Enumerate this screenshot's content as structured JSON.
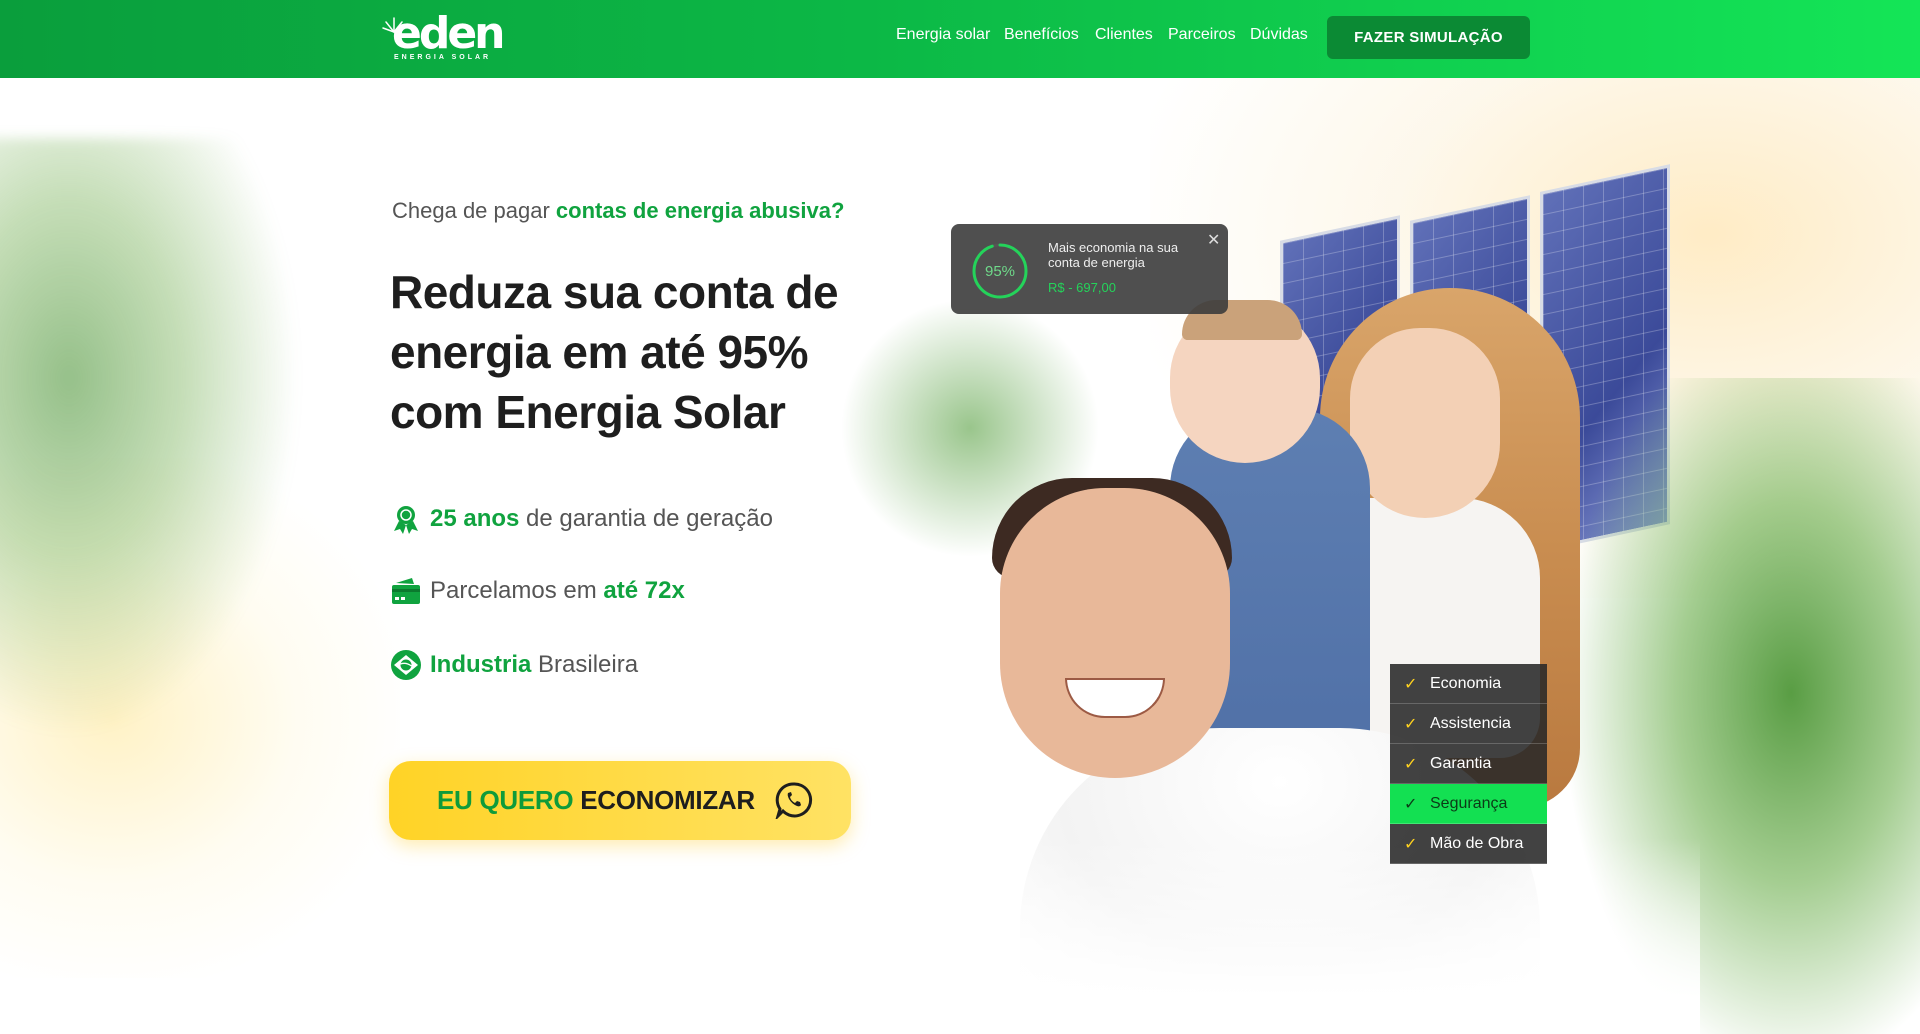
{
  "header": {
    "logo_text": "eden",
    "logo_sub": "ENERGIA SOLAR",
    "nav": [
      {
        "label": "Energia solar"
      },
      {
        "label": "Benefícios"
      },
      {
        "label": "Clientes"
      },
      {
        "label": "Parceiros"
      },
      {
        "label": "Dúvidas"
      }
    ],
    "cta_label": "FAZER SIMULAÇÃO"
  },
  "hero": {
    "kicker_plain": "Chega de pagar ",
    "kicker_highlight": "contas de energia abusiva?",
    "headline": "Reduza sua conta de energia em até 95% com Energia Solar",
    "features": [
      {
        "icon": "award-ribbon-icon",
        "highlight": "25 anos",
        "text": " de garantia de geração"
      },
      {
        "icon": "wallet-card-icon",
        "plain": "Parcelamos em ",
        "highlight": "até 72x"
      },
      {
        "icon": "brazil-flag-icon",
        "highlight": "Industria",
        "text": " Brasileira"
      }
    ],
    "cta_green": "EU QUERO ",
    "cta_dark": "ECONOMIZAR",
    "cta_icon": "whatsapp-icon"
  },
  "savings_card": {
    "percent": "95%",
    "percent_value": 95,
    "title": "Mais economia na sua conta de energia",
    "amount": "R$  - 697,00",
    "close": "✕"
  },
  "checklist": {
    "items": [
      {
        "label": "Economia",
        "active": false
      },
      {
        "label": "Assistencia",
        "active": false
      },
      {
        "label": "Garantia",
        "active": false
      },
      {
        "label": "Segurança",
        "active": true
      },
      {
        "label": "Mão de Obra",
        "active": false
      }
    ]
  },
  "colors": {
    "brand_green": "#10a33f",
    "header_green_start": "#0a9e3c",
    "header_green_end": "#14e557",
    "cta_yellow": "#ffd326",
    "check_yellow": "#ffd21f"
  }
}
